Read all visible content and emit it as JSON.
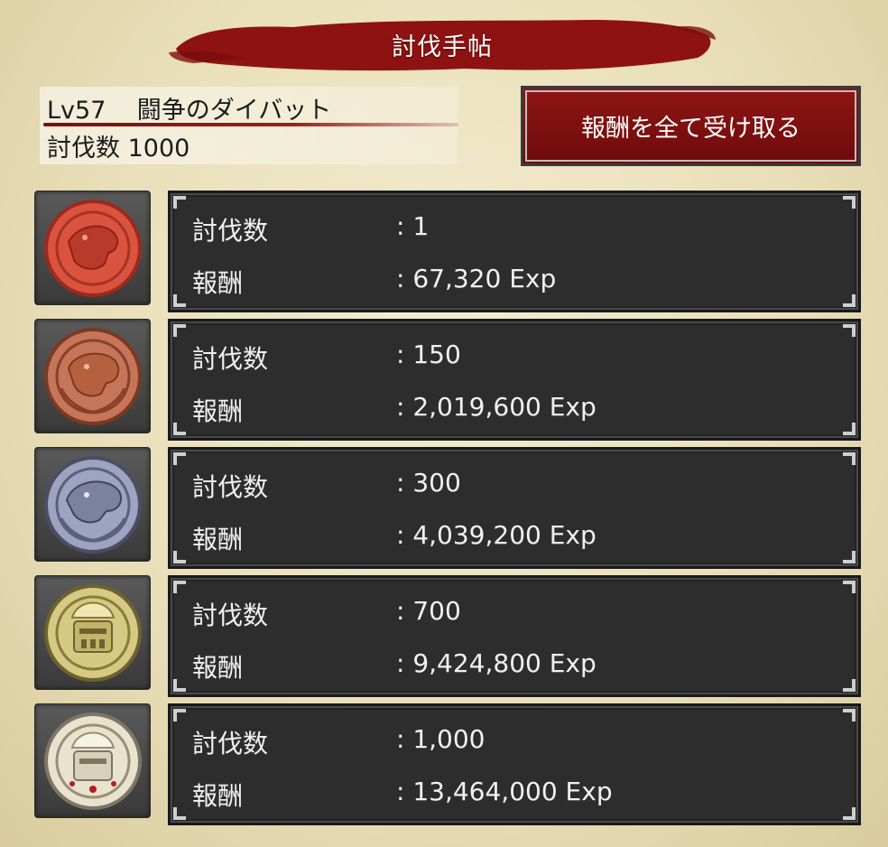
{
  "title": "討伐手帖",
  "info": {
    "level": "Lv57",
    "monster_name": "闘争のダイバット",
    "kills_label": "討伐数",
    "kills_value": "1000"
  },
  "claim_all_label": "報酬を全て受け取る",
  "rows": [
    {
      "icon": "red-beast-medal-icon",
      "kills_label": "討伐数",
      "kills_value": ": 1",
      "reward_label": "報酬",
      "reward_value": ": 67,320 Exp"
    },
    {
      "icon": "bronze-beast-medal-icon",
      "kills_label": "討伐数",
      "kills_value": ": 150",
      "reward_label": "報酬",
      "reward_value": ": 2,019,600 Exp"
    },
    {
      "icon": "silver-beast-medal-icon",
      "kills_label": "討伐数",
      "kills_value": ": 300",
      "reward_label": "報酬",
      "reward_value": ": 4,039,200 Exp"
    },
    {
      "icon": "gold-helmet-medal-icon",
      "kills_label": "討伐数",
      "kills_value": ": 700",
      "reward_label": "報酬",
      "reward_value": ": 9,424,800 Exp"
    },
    {
      "icon": "platinum-helmet-medal-icon",
      "kills_label": "討伐数",
      "kills_value": ": 1,000",
      "reward_label": "報酬",
      "reward_value": ": 13,464,000 Exp"
    }
  ],
  "colors": {
    "banner_red": "#8e1212",
    "button_red": "#7e1010",
    "panel_dark": "#2d2d2d",
    "parchment": "#ece3c2"
  }
}
